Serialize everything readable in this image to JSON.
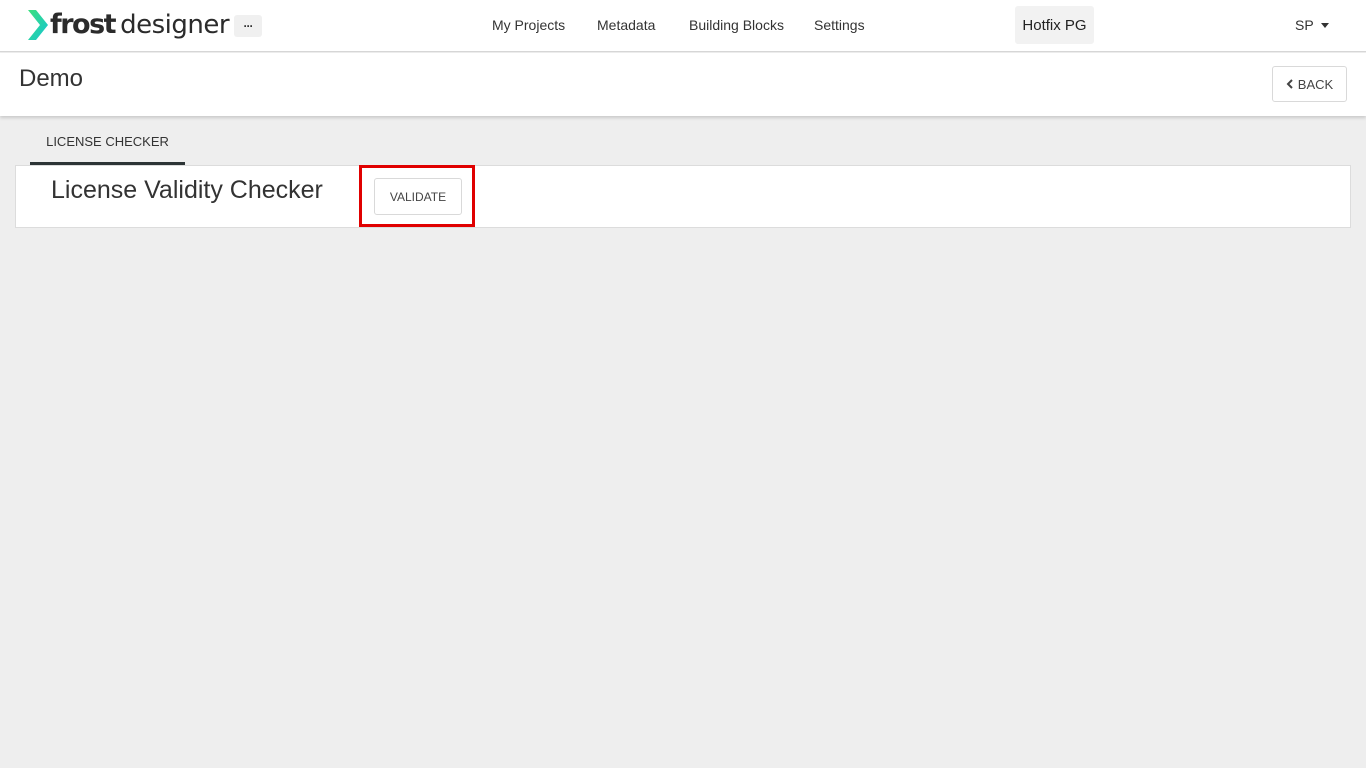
{
  "app": {
    "logo_bold": "frost",
    "logo_light": "designer",
    "more_label": "···"
  },
  "nav": {
    "items": [
      {
        "label": "My Projects"
      },
      {
        "label": "Metadata"
      },
      {
        "label": "Building Blocks"
      },
      {
        "label": "Settings"
      }
    ],
    "environment": "Hotfix PG",
    "user_initials": "SP"
  },
  "page": {
    "title": "Demo",
    "back_label": "BACK"
  },
  "tabs": [
    {
      "label": "LICENSE CHECKER",
      "active": true
    }
  ],
  "card": {
    "title": "License Validity Checker",
    "validate_label": "VALIDATE"
  },
  "colors": {
    "logo_green": "#2fdc8e",
    "logo_teal": "#1fc9c0",
    "highlight": "#e00000",
    "background": "#eeeeee"
  }
}
